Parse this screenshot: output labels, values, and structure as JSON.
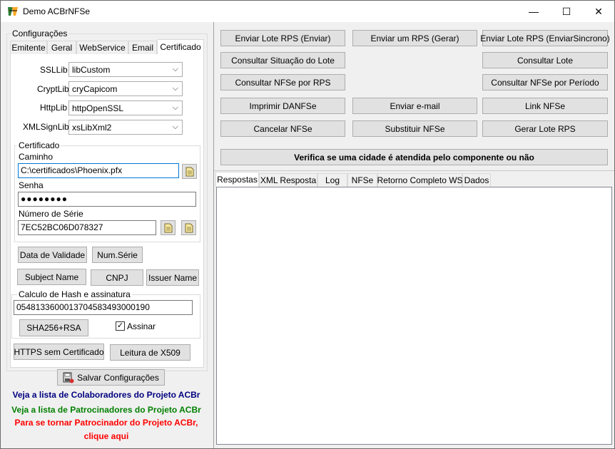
{
  "window": {
    "title": "Demo ACBrNFSe",
    "minimize": "—",
    "maximize": "☐",
    "close": "✕"
  },
  "left": {
    "group_title": "Configurações",
    "tabs": [
      "Emitente",
      "Geral",
      "WebService",
      "Email",
      "Certificado"
    ],
    "libs": [
      {
        "label": "SSLLib",
        "value": "libCustom"
      },
      {
        "label": "CryptLib",
        "value": "cryCapicom"
      },
      {
        "label": "HttpLib",
        "value": "httpOpenSSL"
      },
      {
        "label": "XMLSignLib",
        "value": "xsLibXml2"
      }
    ],
    "cert": {
      "group_title": "Certificado",
      "path_label": "Caminho",
      "path_value": "C:\\certificados\\Phoenix.pfx",
      "password_label": "Senha",
      "password_value": "●●●●●●●●",
      "serial_label": "Número de Série",
      "serial_value": "7EC52BC06D078327"
    },
    "buttons": {
      "validity": "Data de Validade",
      "num_serie": "Num.Série",
      "subject": "Subject Name",
      "cnpj": "CNPJ",
      "issuer": "Issuer Name"
    },
    "hash": {
      "group_title": "Calculo de Hash e assinatura",
      "value": "0548133600013704583493000190",
      "sha_button": "SHA256+RSA",
      "sign_label": "Assinar",
      "sign_checked": true
    },
    "https_button": "HTTPS sem Certificado",
    "x509_button": "Leitura de X509",
    "save_button": "Salvar Configurações",
    "links": [
      {
        "text": "Veja a lista de Colaboradores do Projeto ACBr",
        "color": "#000080"
      },
      {
        "text": "Veja a lista de Patrocinadores do Projeto ACBr",
        "color": "#008000"
      },
      {
        "text": "Para se tornar Patrocinador do Projeto ACBr,",
        "color": "#ff0000"
      },
      {
        "text": "clique aqui",
        "color": "#ff0000"
      }
    ]
  },
  "actions": {
    "enviar_lote": "Enviar Lote RPS (Enviar)",
    "enviar_rps": "Enviar um RPS (Gerar)",
    "enviar_sincrono": "Enviar Lote RPS (EnviarSincrono)",
    "consultar_situacao": "Consultar Situação do Lote",
    "consultar_lote": "Consultar Lote",
    "consultar_por_rps": "Consultar NFSe por RPS",
    "consultar_periodo": "Consultar NFSe por Período",
    "imprimir": "Imprimir DANFSe",
    "email": "Enviar e-mail",
    "link": "Link NFSe",
    "cancelar": "Cancelar NFSe",
    "substituir": "Substituir NFSe",
    "gerar_lote": "Gerar Lote RPS",
    "verifica": "Verifica se uma cidade é atendida pelo componente ou não"
  },
  "output_tabs": [
    "Respostas",
    "XML Resposta",
    "Log",
    "NFSe",
    "Retorno Completo WS",
    "Dados"
  ]
}
